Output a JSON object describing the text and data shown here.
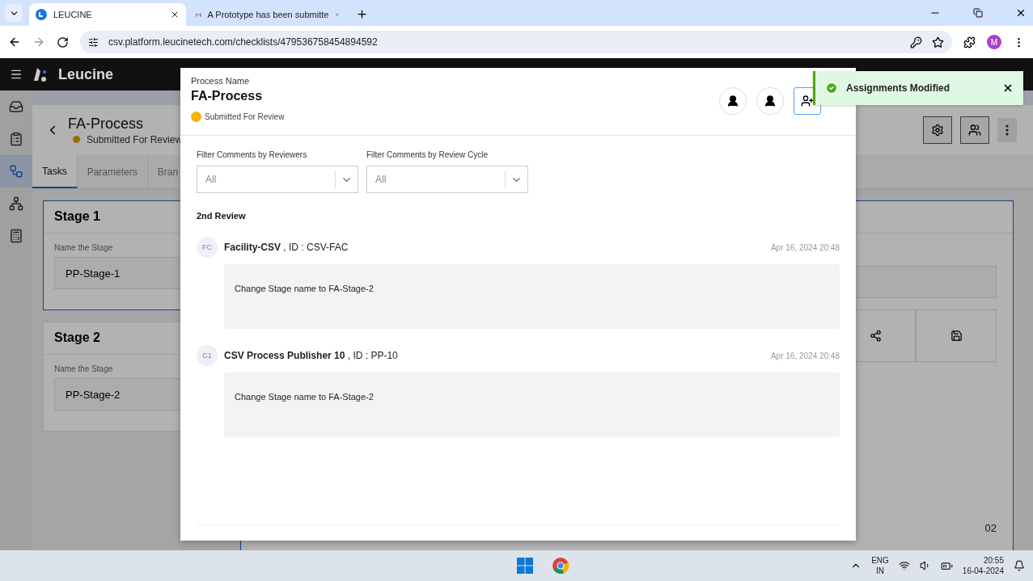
{
  "browser": {
    "tabs": [
      {
        "title": "LEUCINE",
        "kind": "app",
        "selected": true
      },
      {
        "title": "A Prototype has been submitte",
        "kind": "mail",
        "selected": false
      }
    ],
    "url": "csv.platform.leucinetech.com/checklists/479536758454894592",
    "profile": "M"
  },
  "app": {
    "brand": "Leucine"
  },
  "sidebar": {
    "items": [
      {
        "kind": "inbox",
        "selected": false
      },
      {
        "kind": "checklist",
        "selected": false
      },
      {
        "kind": "flow",
        "selected": true
      },
      {
        "kind": "hierarchy",
        "selected": false
      },
      {
        "kind": "report",
        "selected": false
      }
    ]
  },
  "page": {
    "title": "FA-Process",
    "status": "Submitted For Review",
    "tabs": [
      {
        "label": "Tasks",
        "selected": true
      },
      {
        "label": "Parameters",
        "selected": false
      },
      {
        "label": "Bran",
        "selected": false
      }
    ],
    "stages": [
      {
        "title": "Stage 1",
        "field_label": "Name the Stage",
        "value": "PP-Stage-1",
        "selected": true
      },
      {
        "title": "Stage 2",
        "field_label": "Name the Stage",
        "value": "PP-Stage-2",
        "selected": false
      }
    ],
    "task_number": "02"
  },
  "modal": {
    "label": "Process Name",
    "title": "FA-Process",
    "status": "Submitted For Review",
    "filters": [
      {
        "label": "Filter Comments by Reviewers",
        "value": "All"
      },
      {
        "label": "Filter Comments by Review Cycle",
        "value": "All"
      }
    ],
    "section": "2nd Review",
    "comments": [
      {
        "initials": "FC",
        "author": "**Facility-CSV** , ID : CSV-FAC",
        "time": "Apr 16, 2024 20:48",
        "text": "Change Stage name to FA-Stage-2"
      },
      {
        "initials": "C1",
        "author": "**CSV Process Publisher 10** , ID : PP-10",
        "time": "Apr 16, 2024 20:48",
        "text": "Change Stage name to FA-Stage-2"
      }
    ]
  },
  "toast": {
    "message": "Assignments Modified"
  },
  "taskbar": {
    "lang": "ENG",
    "region": "IN",
    "time": "20:55",
    "date": "16-04-2024"
  }
}
